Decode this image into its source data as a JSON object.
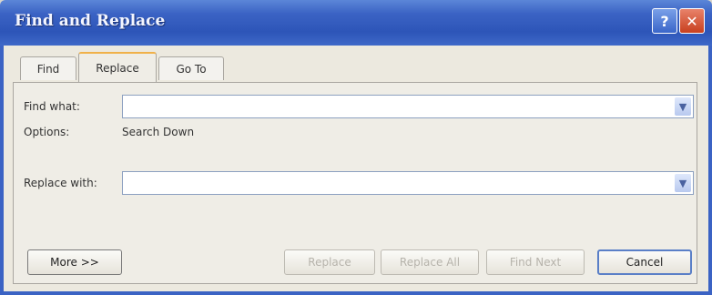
{
  "window": {
    "title": "Find and Replace",
    "help_label": "?",
    "close_label": "✕"
  },
  "tabs": [
    {
      "label": "Find"
    },
    {
      "label": "Replace"
    },
    {
      "label": "Go To"
    }
  ],
  "active_tab": "Replace",
  "find": {
    "label": "Find what:",
    "value": ""
  },
  "options": {
    "label": "Options:",
    "value": "Search Down"
  },
  "replace": {
    "label": "Replace with:",
    "value": ""
  },
  "buttons": {
    "more": "More >>",
    "replace": "Replace",
    "replace_all": "Replace All",
    "find_next": "Find Next",
    "cancel": "Cancel"
  },
  "icons": {
    "dropdown": "chevron-down-icon"
  },
  "colors": {
    "titlebar": "#3b63c4",
    "close_button": "#c8401f",
    "active_tab_accent": "#f0b14a"
  }
}
